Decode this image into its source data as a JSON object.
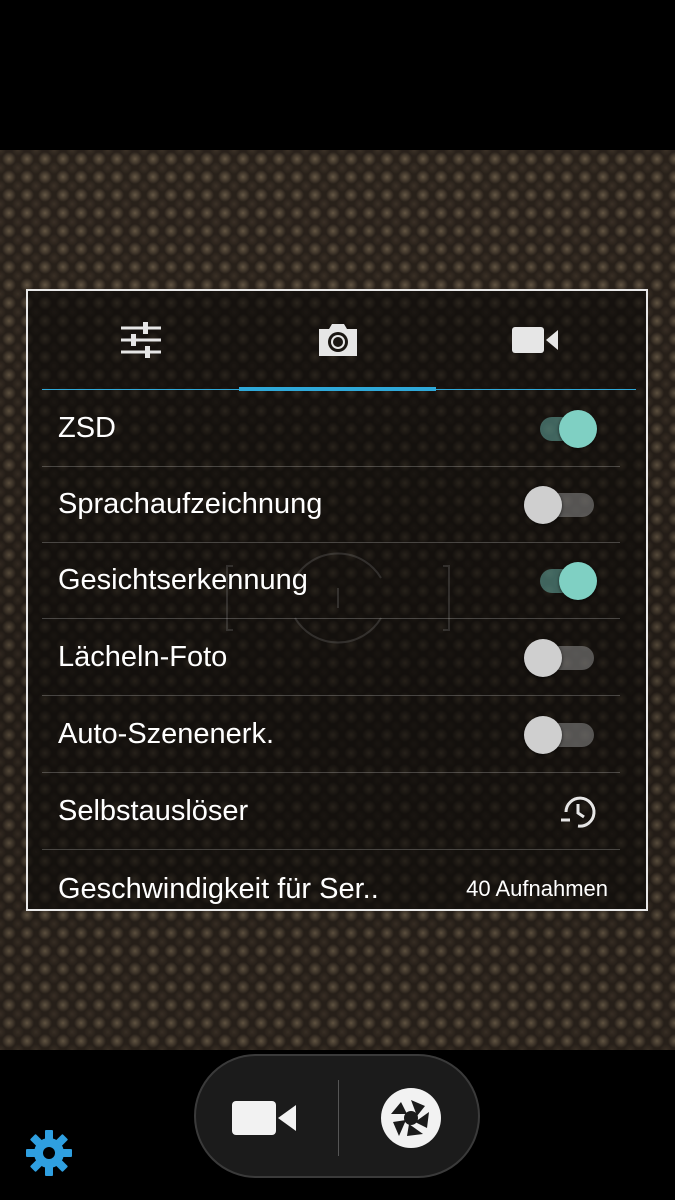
{
  "colors": {
    "accent": "#2fa8d8",
    "toggle_on": "#7fd0c3",
    "toggle_off": "#cfcfcf",
    "gear": "#2f9fe0"
  },
  "tabs": [
    {
      "name": "general-settings-tab",
      "icon": "sliders-icon",
      "selected": false
    },
    {
      "name": "photo-settings-tab",
      "icon": "camera-icon",
      "selected": true
    },
    {
      "name": "video-settings-tab",
      "icon": "video-camera-icon",
      "selected": false
    }
  ],
  "settings": [
    {
      "label": "ZSD",
      "control": "toggle",
      "on": true
    },
    {
      "label": "Sprachaufzeichnung",
      "control": "toggle",
      "on": false
    },
    {
      "label": "Gesichtserkennung",
      "control": "toggle",
      "on": true
    },
    {
      "label": "Lächeln-Foto",
      "control": "toggle",
      "on": false
    },
    {
      "label": "Auto-Szenenerk.",
      "control": "toggle",
      "on": false
    },
    {
      "label": "Selbstauslöser",
      "control": "icon",
      "icon": "timer-icon"
    },
    {
      "label": "Geschwindigkeit für Ser..",
      "control": "value",
      "value": "40 Aufnahmen"
    }
  ],
  "bottom_controls": {
    "record_icon": "video-camera-icon",
    "shutter_icon": "shutter-icon",
    "settings_icon": "gear-icon"
  }
}
